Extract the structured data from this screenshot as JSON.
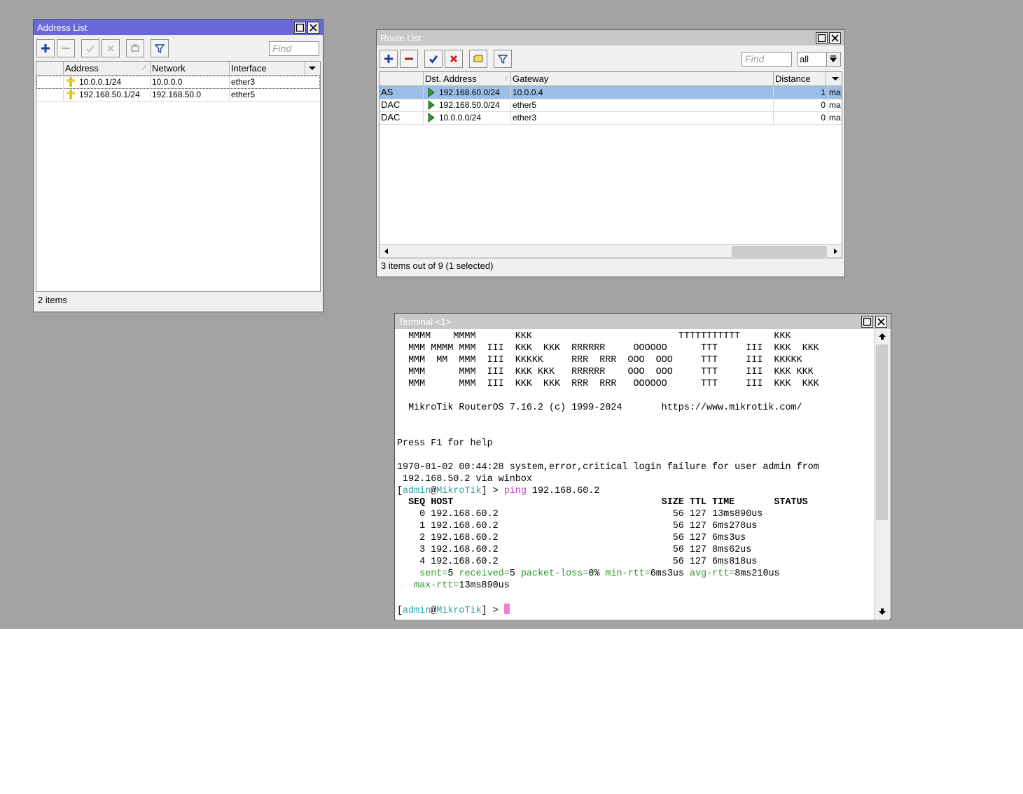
{
  "colors": {
    "desktop": "#a3a3a3",
    "active_title": "#6868d8",
    "inactive_title": "#c8c8c8",
    "selected_row": "#9cbde5",
    "terminal_green": "#2e9a2e",
    "terminal_cyan": "#2aa3a3",
    "terminal_magenta": "#c046c0",
    "cursor": "#f080d0"
  },
  "address_list": {
    "title": "Address List",
    "find_placeholder": "Find",
    "columns": [
      "Address",
      "Network",
      "Interface"
    ],
    "rows": [
      {
        "address": "10.0.0.1/24",
        "network": "10.0.0.0",
        "interface": "ether3"
      },
      {
        "address": "192.168.50.1/24",
        "network": "192.168.50.0",
        "interface": "ether5"
      }
    ],
    "status": "2 items",
    "toolbar_icons": [
      "add-icon",
      "remove-icon",
      "enable-icon",
      "disable-icon",
      "comment-icon",
      "filter-icon"
    ]
  },
  "route_list": {
    "title": "Route List",
    "find_placeholder": "Find",
    "filter_value": "all",
    "columns": [
      "Dst. Address",
      "Gateway",
      "Distance"
    ],
    "rows": [
      {
        "flags": "AS",
        "dst": "192.168.60.0/24",
        "gateway": "10.0.0.4",
        "distance": "1",
        "extra": "ma",
        "selected": true
      },
      {
        "flags": "DAC",
        "dst": "192.168.50.0/24",
        "gateway": "ether5",
        "distance": "0",
        "extra": "ma",
        "selected": false
      },
      {
        "flags": "DAC",
        "dst": "10.0.0.0/24",
        "gateway": "ether3",
        "distance": "0",
        "extra": "ma",
        "selected": false
      }
    ],
    "status": "3 items out of 9 (1 selected)",
    "toolbar_icons": [
      "add-icon",
      "remove-icon",
      "enable-icon",
      "disable-icon",
      "comment-icon",
      "filter-icon"
    ]
  },
  "terminal": {
    "title": "Terminal <1>",
    "banner": [
      "  MMMM    MMMM       KKK                          TTTTTTTTTTT      KKK",
      "  MMM MMMM MMM  III  KKK  KKK  RRRRRR     OOOOOO      TTT     III  KKK  KKK",
      "  MMM  MM  MMM  III  KKKKK     RRR  RRR  OOO  OOO     TTT     III  KKKKK",
      "  MMM      MMM  III  KKK KKK   RRRRRR    OOO  OOO     TTT     III  KKK KKK",
      "  MMM      MMM  III  KKK  KKK  RRR  RRR   OOOOOO      TTT     III  KKK  KKK"
    ],
    "version_line": "  MikroTik RouterOS 7.16.2 (c) 1999-2024       https://www.mikrotik.com/",
    "help_line": "Press F1 for help",
    "log_line_1": "1970-01-02 00:44:28 system,error,critical login failure for user admin from",
    "log_line_2": " 192.168.50.2 via winbox",
    "prompt_user": "admin",
    "prompt_at": "@",
    "prompt_host": "MikroTik",
    "prompt_open": "[",
    "prompt_close": "] > ",
    "command_name": "ping",
    "command_arg": " 192.168.60.2",
    "ping_header": "  SEQ HOST                                     SIZE TTL TIME       STATUS",
    "ping_rows": [
      "    0 192.168.60.2                               56 127 13ms890us",
      "    1 192.168.60.2                               56 127 6ms278us",
      "    2 192.168.60.2                               56 127 6ms3us",
      "    3 192.168.60.2                               56 127 8ms62us",
      "    4 192.168.60.2                               56 127 6ms818us"
    ],
    "summary": {
      "sent_key": "sent=",
      "sent_val": "5",
      "received_key": "received=",
      "received_val": "5",
      "loss_key": "packet-loss=",
      "loss_val": "0%",
      "min_key": "min-rtt=",
      "min_val": "6ms3us",
      "avg_key": "avg-rtt=",
      "avg_val": "8ms210us",
      "max_key": "max-rtt=",
      "max_val": "13ms890us"
    }
  }
}
